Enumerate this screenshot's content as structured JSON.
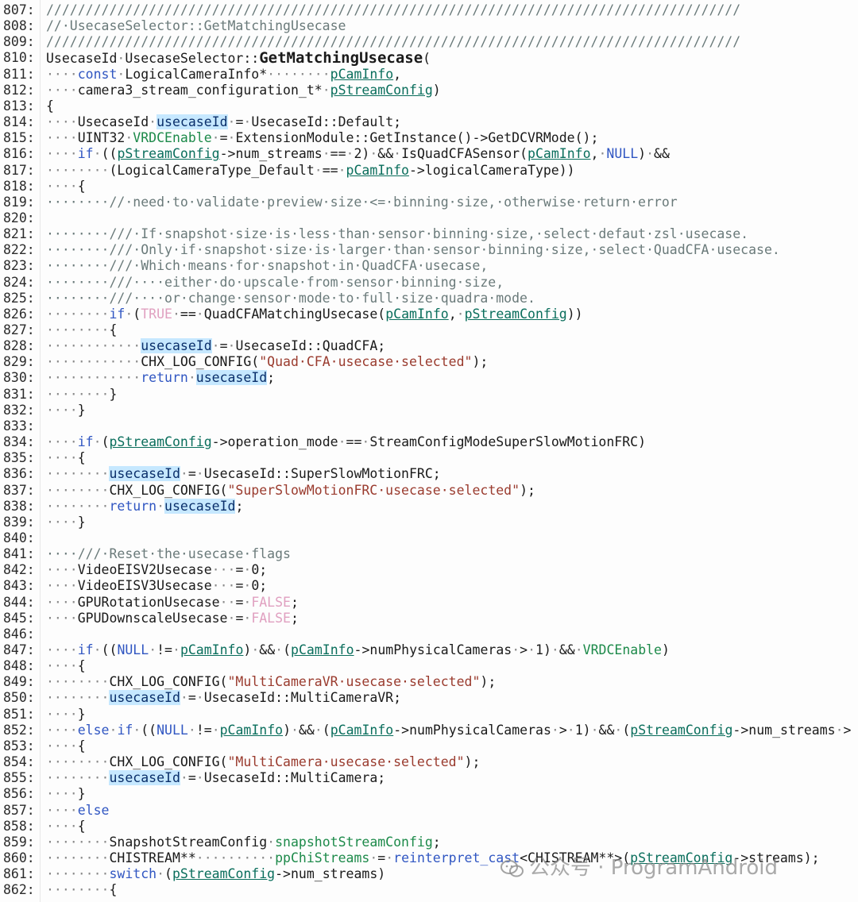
{
  "editor": {
    "lines": [
      {
        "n": "807:",
        "t": "c",
        "s": "////////////////////////////////////////////////////////////////////////////////////////"
      },
      {
        "n": "808:",
        "t": "c",
        "s": "//·UsecaseSelector::GetMatchingUsecase"
      },
      {
        "n": "809:",
        "t": "c",
        "s": "////////////////////////////////////////////////////////////////////////////////////////"
      },
      {
        "n": "810:",
        "t": "p",
        "s": "UsecaseId·UsecaseSelector::GetMatchingUsecase("
      },
      {
        "n": "811:",
        "t": "p",
        "s": "····const·LogicalCameraInfo*········pCamInfo,"
      },
      {
        "n": "812:",
        "t": "p",
        "s": "····camera3_stream_configuration_t*·pStreamConfig)"
      },
      {
        "n": "813:",
        "t": "p",
        "s": "{"
      },
      {
        "n": "814:",
        "t": "p",
        "s": "····UsecaseId·usecaseId·=·UsecaseId::Default;"
      },
      {
        "n": "815:",
        "t": "p",
        "s": "····UINT32·VRDCEnable·=·ExtensionModule::GetInstance()->GetDCVRMode();"
      },
      {
        "n": "816:",
        "t": "p",
        "s": "····if·((pStreamConfig->num_streams·==·2)·&&·IsQuadCFASensor(pCamInfo,·NULL)·&&"
      },
      {
        "n": "817:",
        "t": "p",
        "s": "········(LogicalCameraType_Default·==·pCamInfo->logicalCameraType))"
      },
      {
        "n": "818:",
        "t": "p",
        "s": "····{"
      },
      {
        "n": "819:",
        "t": "c",
        "s": "········//·need·to·validate·preview·size·<=·binning·size,·otherwise·return·error"
      },
      {
        "n": "820:",
        "t": "p",
        "s": ""
      },
      {
        "n": "821:",
        "t": "c",
        "s": "········///·If·snapshot·size·is·less·than·sensor·binning·size,·select·defaut·zsl·usecase."
      },
      {
        "n": "822:",
        "t": "c",
        "s": "········///·Only·if·snapshot·size·is·larger·than·sensor·binning·size,·select·QuadCFA·usecase."
      },
      {
        "n": "823:",
        "t": "c",
        "s": "········///·Which·means·for·snapshot·in·QuadCFA·usecase,"
      },
      {
        "n": "824:",
        "t": "c",
        "s": "········///····either·do·upscale·from·sensor·binning·size,"
      },
      {
        "n": "825:",
        "t": "c",
        "s": "········///····or·change·sensor·mode·to·full·size·quadra·mode."
      },
      {
        "n": "826:",
        "t": "p",
        "s": "········if·(TRUE·==·QuadCFAMatchingUsecase(pCamInfo,·pStreamConfig))"
      },
      {
        "n": "827:",
        "t": "p",
        "s": "········{"
      },
      {
        "n": "828:",
        "t": "p",
        "s": "············usecaseId·=·UsecaseId::QuadCFA;"
      },
      {
        "n": "829:",
        "t": "p",
        "s": "············CHX_LOG_CONFIG(\"Quad·CFA·usecase·selected\");"
      },
      {
        "n": "830:",
        "t": "p",
        "s": "············return·usecaseId;"
      },
      {
        "n": "831:",
        "t": "p",
        "s": "········}"
      },
      {
        "n": "832:",
        "t": "p",
        "s": "····}"
      },
      {
        "n": "833:",
        "t": "p",
        "s": ""
      },
      {
        "n": "834:",
        "t": "p",
        "s": "····if·(pStreamConfig->operation_mode·==·StreamConfigModeSuperSlowMotionFRC)"
      },
      {
        "n": "835:",
        "t": "p",
        "s": "····{"
      },
      {
        "n": "836:",
        "t": "p",
        "s": "········usecaseId·=·UsecaseId::SuperSlowMotionFRC;"
      },
      {
        "n": "837:",
        "t": "p",
        "s": "········CHX_LOG_CONFIG(\"SuperSlowMotionFRC·usecase·selected\");"
      },
      {
        "n": "838:",
        "t": "p",
        "s": "········return·usecaseId;"
      },
      {
        "n": "839:",
        "t": "p",
        "s": "····}"
      },
      {
        "n": "840:",
        "t": "p",
        "s": ""
      },
      {
        "n": "841:",
        "t": "c",
        "s": "····///·Reset·the·usecase·flags"
      },
      {
        "n": "842:",
        "t": "p",
        "s": "····VideoEISV2Usecase···=·0;"
      },
      {
        "n": "843:",
        "t": "p",
        "s": "····VideoEISV3Usecase···=·0;"
      },
      {
        "n": "844:",
        "t": "p",
        "s": "····GPURotationUsecase··=·FALSE;"
      },
      {
        "n": "845:",
        "t": "p",
        "s": "····GPUDownscaleUsecase·=·FALSE;"
      },
      {
        "n": "846:",
        "t": "p",
        "s": ""
      },
      {
        "n": "847:",
        "t": "p",
        "s": "····if·((NULL·!=·pCamInfo)·&&·(pCamInfo->numPhysicalCameras·>·1)·&&·VRDCEnable)"
      },
      {
        "n": "848:",
        "t": "p",
        "s": "····{"
      },
      {
        "n": "849:",
        "t": "p",
        "s": "········CHX_LOG_CONFIG(\"MultiCameraVR·usecase·selected\");"
      },
      {
        "n": "850:",
        "t": "p",
        "s": "········usecaseId·=·UsecaseId::MultiCameraVR;"
      },
      {
        "n": "851:",
        "t": "p",
        "s": "····}"
      },
      {
        "n": "852:",
        "t": "p",
        "s": "····else·if·((NULL·!=·pCamInfo)·&&·(pCamInfo->numPhysicalCameras·>·1)·&&·(pStreamConfig->num_streams·>"
      },
      {
        "n": "853:",
        "t": "p",
        "s": "····{"
      },
      {
        "n": "854:",
        "t": "p",
        "s": "········CHX_LOG_CONFIG(\"MultiCamera·usecase·selected\");"
      },
      {
        "n": "855:",
        "t": "p",
        "s": "········usecaseId·=·UsecaseId::MultiCamera;"
      },
      {
        "n": "856:",
        "t": "p",
        "s": "····}"
      },
      {
        "n": "857:",
        "t": "p",
        "s": "····else"
      },
      {
        "n": "858:",
        "t": "p",
        "s": "····{"
      },
      {
        "n": "859:",
        "t": "p",
        "s": "········SnapshotStreamConfig·snapshotStreamConfig;"
      },
      {
        "n": "860:",
        "t": "p",
        "s": "········CHISTREAM**··········ppChiStreams·=·reinterpret_cast<CHISTREAM**>(pStreamConfig->streams);"
      },
      {
        "n": "861:",
        "t": "p",
        "s": "········switch·(pStreamConfig->num_streams)"
      },
      {
        "n": "862:",
        "t": "p",
        "s": "········{"
      }
    ]
  },
  "watermark": {
    "text": "公众号 · ProgramAndroid",
    "icon": "wechat-icon"
  },
  "colors": {
    "keyword": "#3056c2",
    "comment": "#6a7a7a",
    "string": "#9a3b2e",
    "highlight": "#c6e8ff"
  }
}
